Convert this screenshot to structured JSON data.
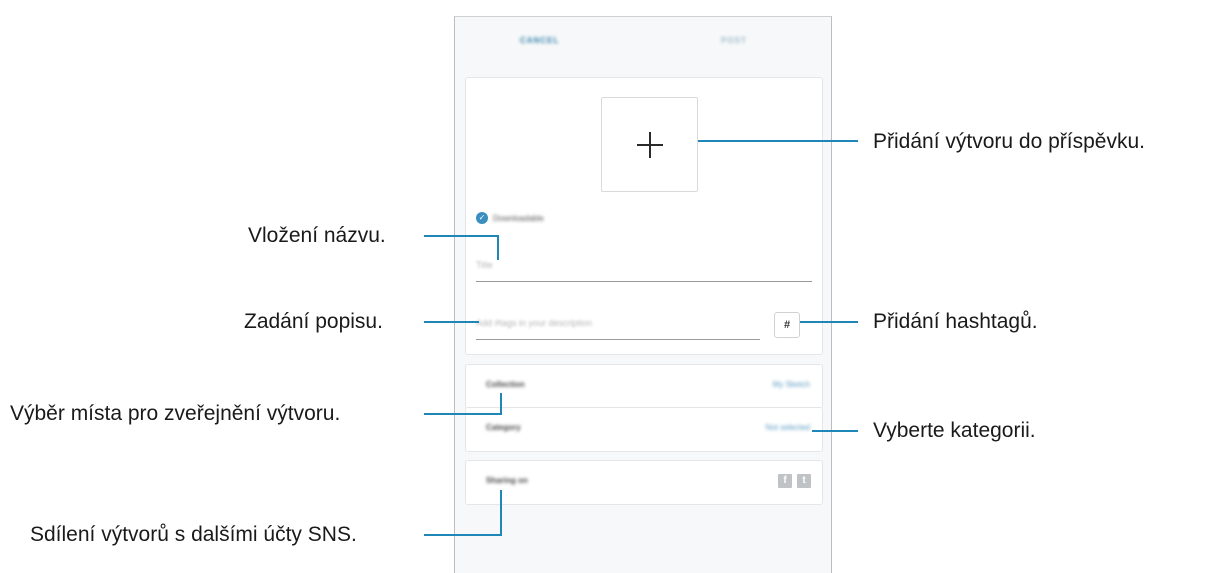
{
  "header": {
    "cancel": "CANCEL",
    "post": "POST"
  },
  "form": {
    "downloadable": "Downloadable",
    "title_placeholder": "Title",
    "description_placeholder": "Add #tags in your description",
    "hashtag_button": "#"
  },
  "rows": {
    "collection_label": "Collection",
    "collection_value": "My Sketch",
    "category_label": "Category",
    "category_value": "Not selected",
    "sharing_label": "Sharing on"
  },
  "sns": {
    "facebook": "f",
    "twitter": "t"
  },
  "callouts": {
    "add_work": "Přidání výtvoru do příspěvku.",
    "title": "Vložení názvu.",
    "description": "Zadání popisu.",
    "hashtags": "Přidání hashtagů.",
    "collection": "Výběr místa pro zveřejnění výtvoru.",
    "category": "Vyberte kategorii.",
    "sharing": "Sdílení výtvorů s dalšími účty SNS."
  },
  "colors": {
    "accent": "#1f86b8",
    "check": "#3a8fc0"
  }
}
